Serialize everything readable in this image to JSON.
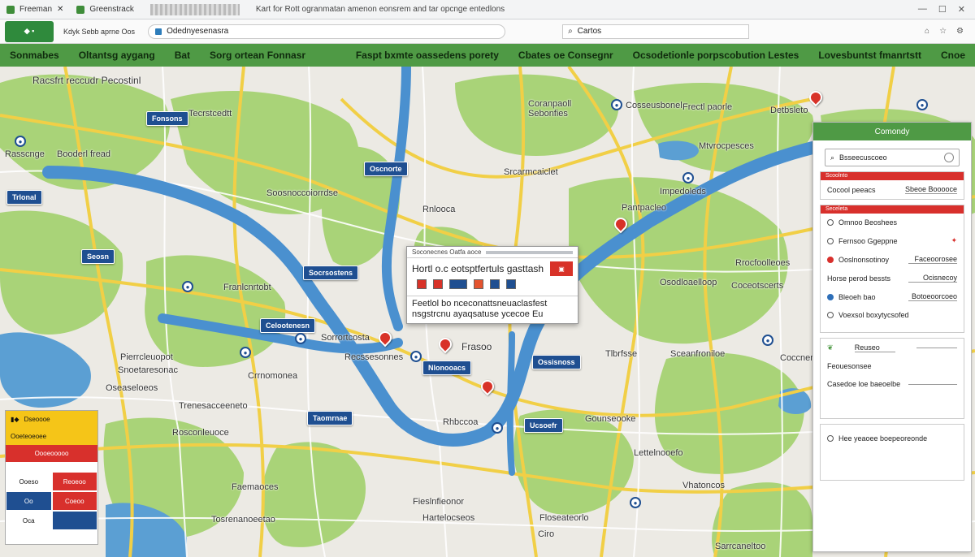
{
  "browser": {
    "tab_label": "Freeman",
    "site_tab": "Greenstrack",
    "title_text": "Kart for Rott ogranmatan amenon eonsrem and tar opcnge entedlons",
    "site_info": "Kdyk Sebb aprne Oos",
    "url_text": "Odednyesenasra",
    "search_label": "Cartos"
  },
  "menu": {
    "items": [
      "Sonmabes",
      "Oltantsg aygang",
      "Bat",
      "Sorg ortean Fonnasr",
      "Faspt bxmte oassedens porety",
      "Cbates oe Consegnr",
      "Ocsodetionle porpscobution Lestes",
      "Lovesbuntst fmanrtstt",
      "Cnoe"
    ]
  },
  "map_labels": {
    "top_left": "Racsfrt reccudr Pecostinl",
    "l1": "Rasscnge",
    "l2": "Booderl fread",
    "c1": "Tecrstcedtt",
    "c2": "Sebonfies",
    "c3": "Coranpaoll",
    "c4": "Cosseusbonel",
    "c5": "Mtvrocpesces",
    "c6": "Soosnoccoiorrdse",
    "c7": "Rnlooca",
    "r1": "Frectl paorle",
    "r2": "Detbsleto",
    "r3": "Srcarmcaiclet",
    "r4": "Impedoleds",
    "r5": "Pantpacleo",
    "r6": "Rrocfoolleoes",
    "r7": "Osodloaelloop",
    "r8": "Coceotscerts",
    "r9": "Coccnenes",
    "m1": "Franlcnrtobt",
    "m2": "Sorrortcosta",
    "m3": "Pierrcleuopot",
    "m4": "Recssesonnes",
    "m5": "Snoetaresonac",
    "m6": "Crrnomonea",
    "m7": "Oseaseloeos",
    "m8": "Frasoo",
    "m9": "Tlbrfsse",
    "m10": "Sceanfroniloe",
    "m11": "Gounseooke",
    "m12": "Rhbccoa",
    "m13": "Trenesacceeneto",
    "b1": "Rosconleuoce",
    "b2": "Faemaoces",
    "b3": "Tosrenanoeetao",
    "b4": "Fieslnfieonor",
    "b5": "Hartelocseos",
    "b6": "Floseateorlo",
    "b7": "Ciro",
    "b8": "Lettelnooefo",
    "b9": "Vhatoncos",
    "b10": "Sarrcaneltoo"
  },
  "signs": [
    "Fonsons",
    "Oscnorte",
    "Trlonal",
    "Seosn",
    "Socrsostens",
    "Celootenesn",
    "Nlonooacs",
    "Ossisnoss",
    "Taomrnae",
    "Ucsoefr"
  ],
  "popup": {
    "header": "Soconecnes Oatfa aoce",
    "title": "Hortl o.c eotsptfertuls gasttash",
    "footer_line1": "Feetlol bo nceconattsneuaclasfest",
    "footer_line2": "nsgstrcnu ayaqsatuse ycecoe Eu"
  },
  "right_panel": {
    "header": "Comondy",
    "search_placeholder": "Bsseecuscoeo",
    "sec1_bar": "Scoolnto",
    "sec1_row_label": "Cocool peeacs",
    "sec1_row_value": "Sbeoe Booooce",
    "sec2_bar": "Seceleta",
    "sec2_title": "Omnoo Beoshees",
    "rows": [
      {
        "label": "Fernsoo Ggeppne",
        "value": ""
      },
      {
        "label": "Ooslnonsotinoy",
        "value": "Faceoorosee"
      },
      {
        "label": "Horse perod bessts",
        "value": "Ocisnecoy"
      },
      {
        "label": "Bleoeh bao",
        "value": "Botoeoorcoeo"
      },
      {
        "label": "Voexsol boxytycsofed",
        "value": ""
      }
    ],
    "sec3": [
      {
        "label": "",
        "value": "Reuseo"
      },
      {
        "label": "Feouesonsee",
        "value": ""
      },
      {
        "label": "Casedoe loe baeoelbe",
        "value": ""
      }
    ],
    "sec4_label": "Hee yeaoee boepeoreonde"
  },
  "legend": {
    "row1": "Dseoooe",
    "row2": "Ooeteoeoee",
    "row3": "Oooeooooo",
    "cells": [
      "Ooeso",
      "Reoeoo",
      "Oo",
      "Coeoo",
      "Oca",
      ""
    ]
  }
}
